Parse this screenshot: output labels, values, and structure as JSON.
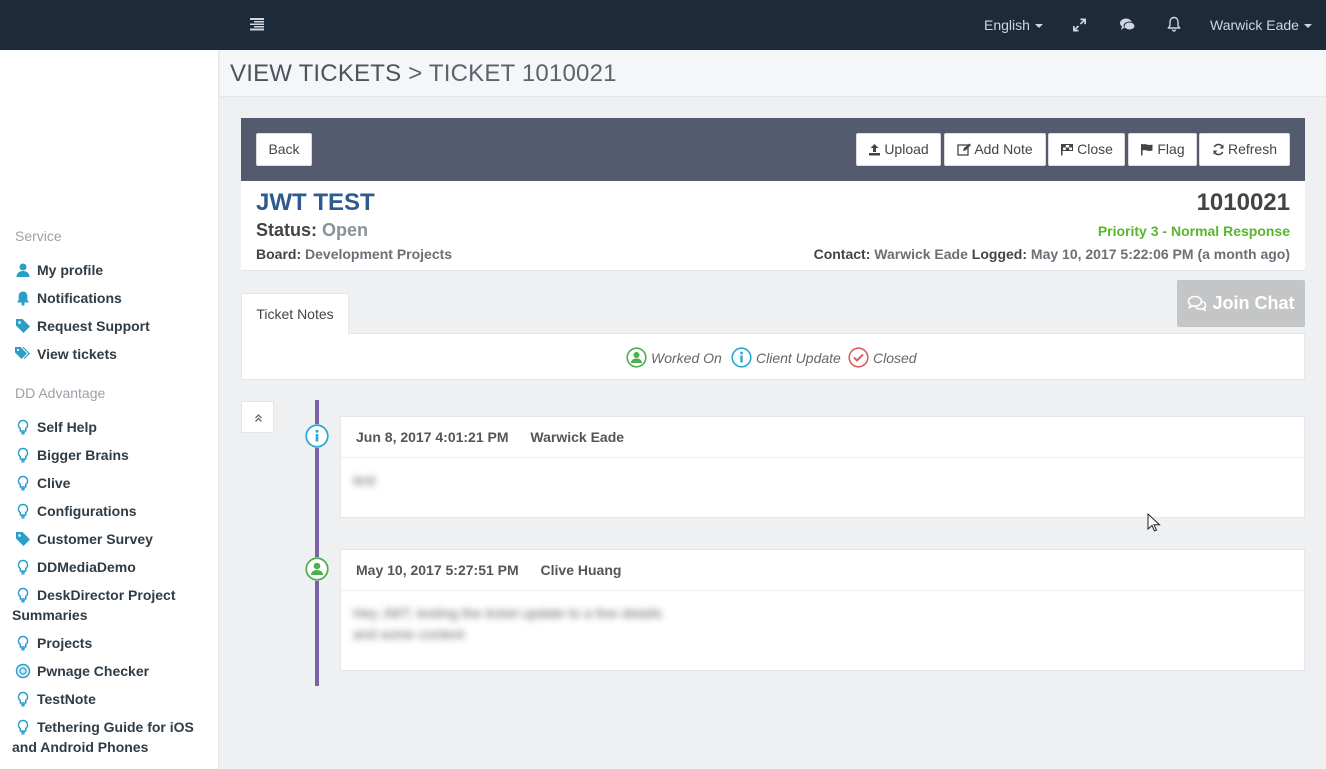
{
  "topbar": {
    "language": "English",
    "user_name": "Warwick Eade"
  },
  "sidebar": {
    "sections": [
      {
        "header": "Service",
        "items": [
          {
            "label": "My profile",
            "icon": "user-icon"
          },
          {
            "label": "Notifications",
            "icon": "bell-icon"
          },
          {
            "label": "Request Support",
            "icon": "tag-icon"
          },
          {
            "label": "View tickets",
            "icon": "tags-icon"
          }
        ]
      },
      {
        "header": "DD Advantage",
        "items": [
          {
            "label": "Self Help",
            "icon": "lightbulb-icon"
          },
          {
            "label": "Bigger Brains",
            "icon": "lightbulb-icon"
          },
          {
            "label": "Clive",
            "icon": "lightbulb-icon"
          },
          {
            "label": "Configurations",
            "icon": "lightbulb-icon"
          },
          {
            "label": "Customer Survey",
            "icon": "tag-icon"
          },
          {
            "label": "DDMediaDemo",
            "icon": "lightbulb-icon"
          },
          {
            "label": "DeskDirector Project Summaries",
            "icon": "lightbulb-icon"
          },
          {
            "label": "Projects",
            "icon": "lightbulb-icon"
          },
          {
            "label": "Pwnage Checker",
            "icon": "shield-icon"
          },
          {
            "label": "TestNote",
            "icon": "lightbulb-icon"
          },
          {
            "label": "Tethering Guide for iOS and Android Phones",
            "icon": "lightbulb-icon"
          }
        ]
      }
    ]
  },
  "breadcrumb": {
    "root": "VIEW TICKETS",
    "separator": ">",
    "current": "TICKET 1010021"
  },
  "toolbar": {
    "back": "Back",
    "upload": "Upload",
    "add_note": "Add Note",
    "close": "Close",
    "flag": "Flag",
    "refresh": "Refresh"
  },
  "ticket": {
    "subject": "JWT TEST",
    "status_label": "Status:",
    "status": "Open",
    "board_label": "Board:",
    "board": "Development Projects",
    "number": "1010021",
    "priority": "Priority 3 - Normal Response",
    "contact_label": "Contact:",
    "contact": "Warwick Eade",
    "logged_label": "Logged:",
    "logged": "May 10, 2017 5:22:06 PM (a month ago)"
  },
  "tabs": {
    "notes": "Ticket Notes"
  },
  "join_chat": "Join Chat",
  "legend": {
    "worked_on": "Worked On",
    "client_update": "Client Update",
    "closed": "Closed"
  },
  "notes": [
    {
      "timestamp": "Jun 8, 2017 4:01:21 PM",
      "author": "Warwick Eade",
      "type": "client-update",
      "body_lines": [
        "test"
      ]
    },
    {
      "timestamp": "May 10, 2017 5:27:51 PM",
      "author": "Clive Huang",
      "type": "worked-on",
      "body_lines": [
        "Hey JWT, testing the ticket update to a few details",
        "and some content"
      ]
    }
  ],
  "colors": {
    "topbar": "#1c2a3a",
    "ticket_header": "#555b6e",
    "subject": "#2e5b8e",
    "priority": "#58b52d",
    "timeline": "#7a62a8",
    "worked_on": "#4caf50",
    "client_update": "#29a8d4",
    "closed": "#e05b5b",
    "sidebar_icon": "#2a9dc8"
  }
}
